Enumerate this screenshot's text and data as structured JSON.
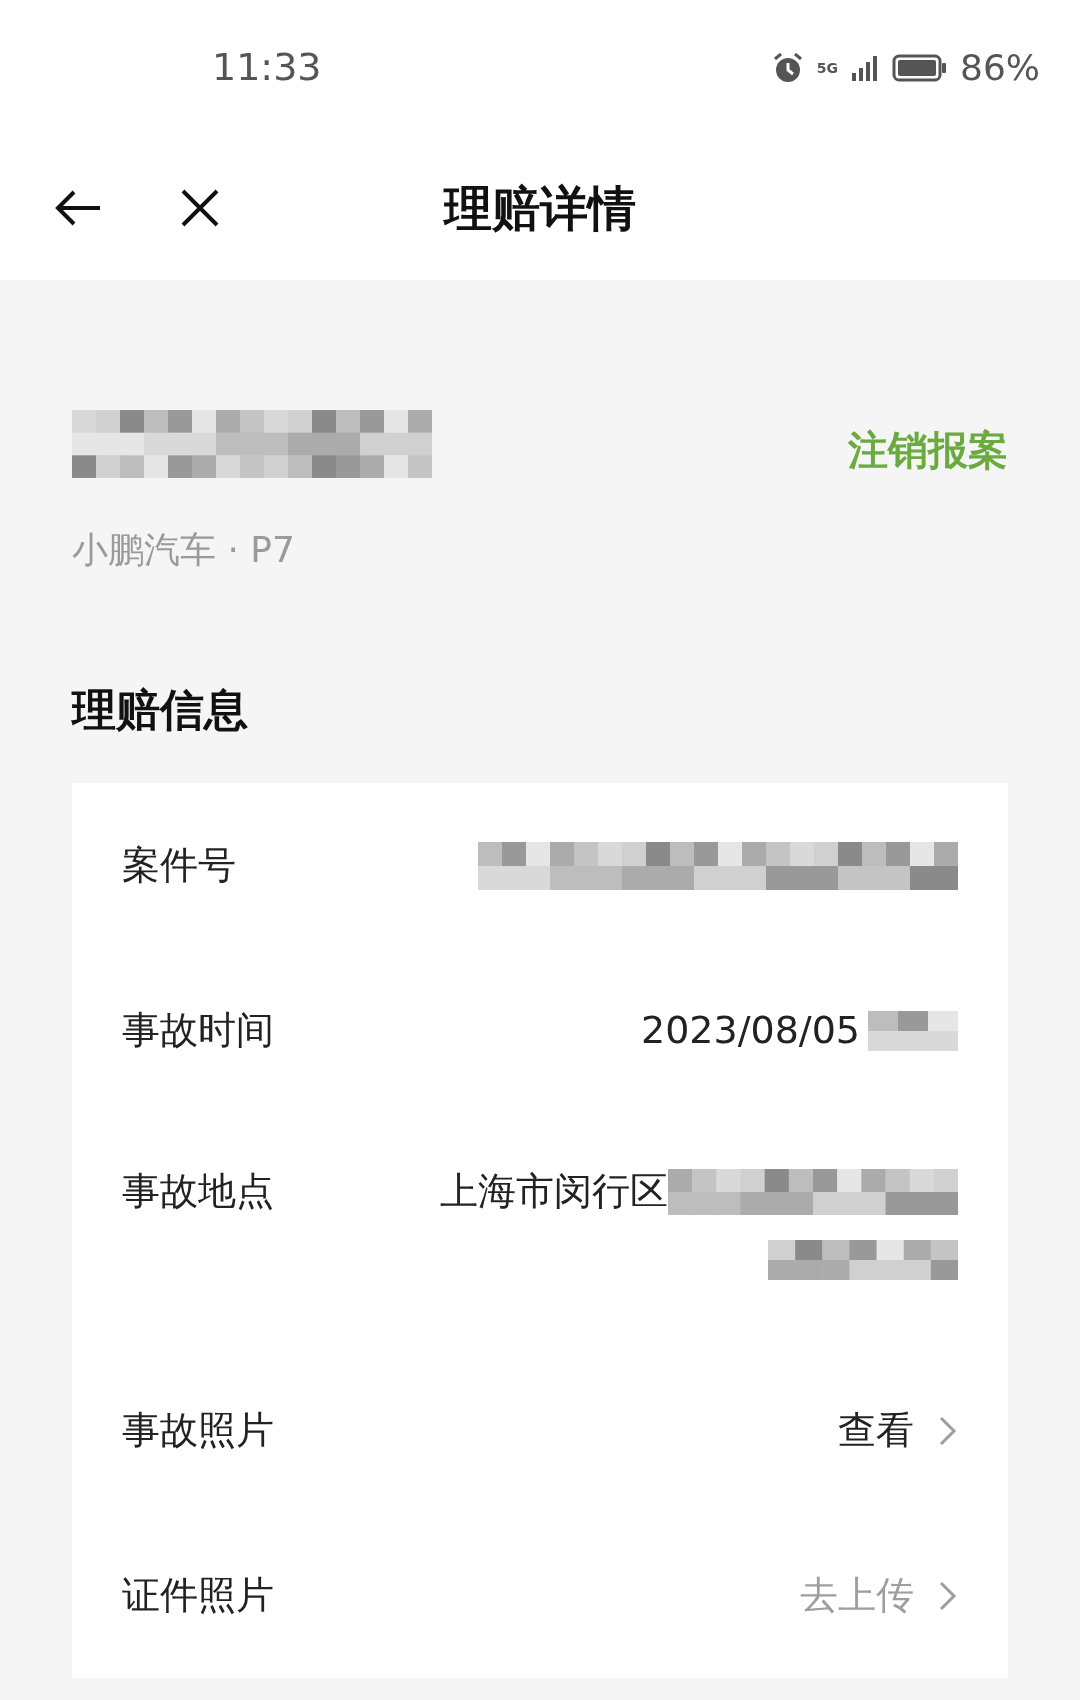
{
  "status_bar": {
    "time": "11:33",
    "network": "5G",
    "battery": "86%"
  },
  "header": {
    "title": "理赔详情"
  },
  "vehicle": {
    "plate_redacted": true,
    "model": "小鹏汽车 · P7",
    "action": "注销报案"
  },
  "section": {
    "title": "理赔信息"
  },
  "rows": [
    {
      "kind": "text",
      "label": "案件号",
      "redacted": true
    },
    {
      "kind": "text",
      "label": "事故时间",
      "value": "2023/08/05",
      "redacted": true
    },
    {
      "kind": "address",
      "label": "事故地点",
      "value": "上海市闵行区",
      "redacted": true
    },
    {
      "kind": "link",
      "label": "事故照片",
      "value": "查看",
      "muted": false
    },
    {
      "kind": "link",
      "label": "证件照片",
      "value": "去上传",
      "muted": true
    }
  ]
}
